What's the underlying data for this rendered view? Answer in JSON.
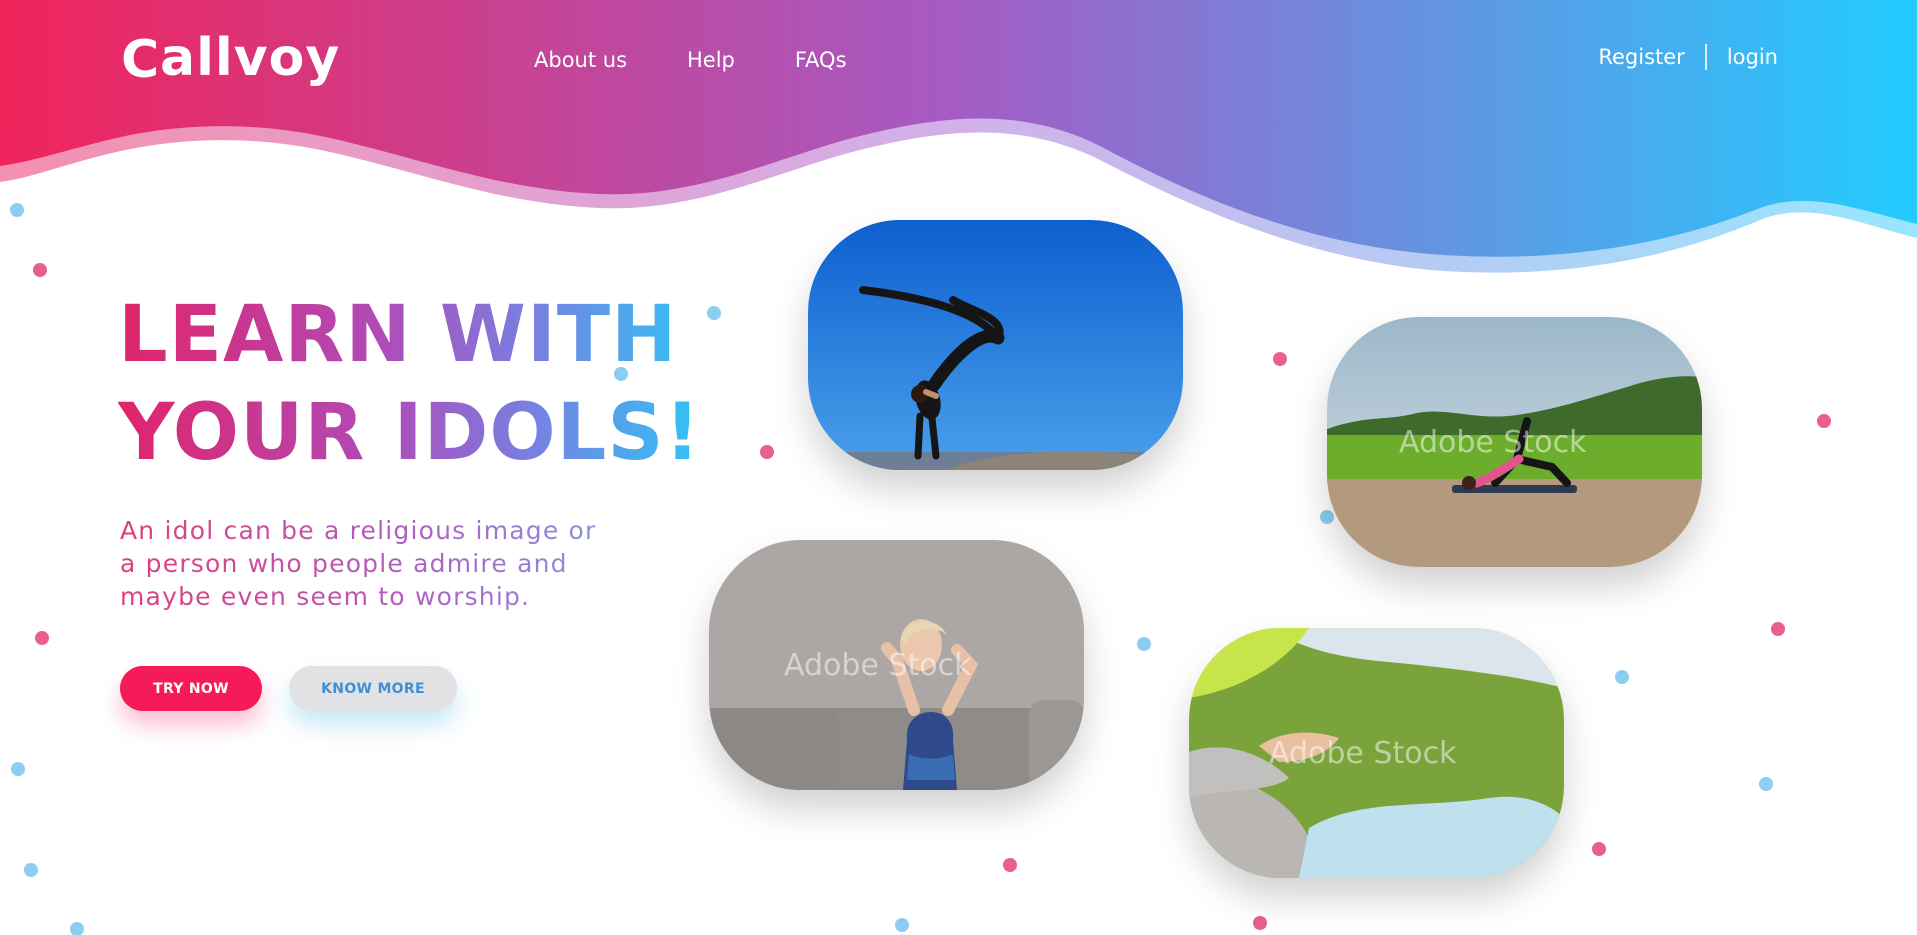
{
  "brand": {
    "name": "allvoy",
    "logo_initial": "C"
  },
  "nav": {
    "items": [
      {
        "label": "About us"
      },
      {
        "label": "Help"
      },
      {
        "label": "FAQs"
      }
    ]
  },
  "auth": {
    "register_label": "Register",
    "login_label": "login"
  },
  "hero": {
    "headline_line1": "LEARN WITH",
    "headline_line2": "YOUR IDOLS!",
    "sub_line1": "An idol can be a religious image or",
    "sub_line2": "a person who people admire and",
    "sub_line3": "maybe even seem to worship.",
    "try_label": "TRY NOW",
    "know_label": "KNOW MORE"
  },
  "photos": {
    "watermark": "Adobe Stock"
  },
  "colors": {
    "gradient_start": "#f0245b",
    "gradient_mid": "#a45cc4",
    "gradient_end": "#22ccff",
    "accent_pink": "#f51a5a",
    "accent_blue": "#3f8fd6"
  }
}
